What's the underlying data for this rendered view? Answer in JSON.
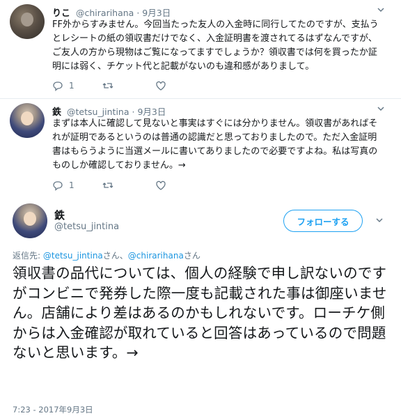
{
  "replies": [
    {
      "name": "りこ",
      "handle": "@chirarihana",
      "sep": "·",
      "date": "9月3日",
      "text": "FF外からすみません。今回当たった友人の入金時に同行してたのですが、支払うとレシートの紙の領収書だけでなく、入金証明書を渡されてるはずなんですが、ご友人の方から現物はご覧になってますでしょうか？領収書では何を買ったか証明には弱く、チケット代と記載がないのも違和感がありまして。",
      "reply_count": "1",
      "retweet_count": "",
      "like_count": ""
    },
    {
      "name": "鉄",
      "handle": "@tetsu_jintina",
      "sep": "·",
      "date": "9月3日",
      "text": "まずは本人に確認して見ないと事実はすぐには分かりません。領収書があればそれが証明であるというのは普通の認識だと思っておりましたので。ただ入金証明書はもらうように当選メールに書いてありましたので必要ですよね。私は写真のものしか確認しておりません。→",
      "reply_count": "1",
      "retweet_count": "",
      "like_count": ""
    }
  ],
  "main": {
    "name": "鉄",
    "handle": "@tetsu_jintina",
    "follow_label": "フォローする",
    "reply_to_prefix": "返信先: ",
    "reply_to_user1": "@tetsu_jintina",
    "reply_to_mid": "さん、",
    "reply_to_user2": "@chirarihana",
    "reply_to_suffix": "さん",
    "text": "領収書の品代については、個人の経験で申し訳ないのですがコンビニで発券した際一度も記載された事は御座いません。店舗により差はあるのかもしれないです。ローチケ側からは入金確認が取れていると回答はあっているので問題ないと思います。→",
    "timestamp": "7:23 - 2017年9月3日"
  },
  "colors": {
    "link": "#1b95e0",
    "accent": "#1da1f2",
    "muted": "#657786",
    "text": "#14171a"
  },
  "icons": [
    "reply-icon",
    "retweet-icon",
    "like-icon",
    "chevron-down-icon"
  ]
}
